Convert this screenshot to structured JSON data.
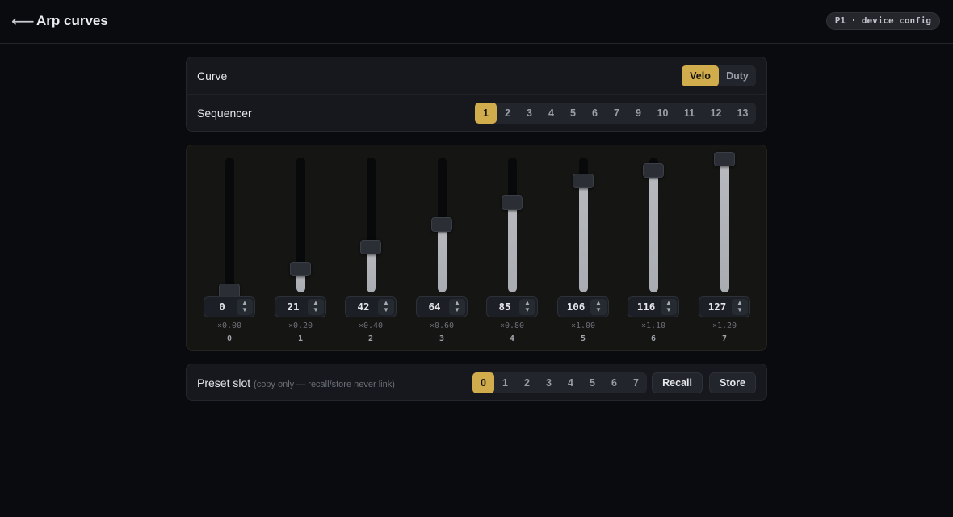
{
  "header": {
    "back_icon": "arrow-left-icon",
    "back_glyph": "⟵",
    "title": "Arp curves",
    "badge": "P1 · device config"
  },
  "curve": {
    "label": "Curve",
    "options": [
      "Velo",
      "Duty"
    ],
    "selected": "Velo"
  },
  "sequencer": {
    "label": "Sequencer",
    "options": [
      "1",
      "2",
      "3",
      "4",
      "5",
      "6",
      "7",
      "9",
      "10",
      "11",
      "12",
      "13"
    ],
    "selected": "1"
  },
  "faders": [
    {
      "value": "0",
      "multiplier": "×0.00",
      "index": "0",
      "level": 0
    },
    {
      "value": "21",
      "multiplier": "×0.20",
      "index": "1",
      "level": 21
    },
    {
      "value": "42",
      "multiplier": "×0.40",
      "index": "2",
      "level": 42
    },
    {
      "value": "64",
      "multiplier": "×0.60",
      "index": "3",
      "level": 64
    },
    {
      "value": "85",
      "multiplier": "×0.80",
      "index": "4",
      "level": 85
    },
    {
      "value": "106",
      "multiplier": "×1.00",
      "index": "5",
      "level": 106
    },
    {
      "value": "116",
      "multiplier": "×1.10",
      "index": "6",
      "level": 116
    },
    {
      "value": "127",
      "multiplier": "×1.20",
      "index": "7",
      "level": 127
    }
  ],
  "fader_max": 127,
  "stepper_icon": "chevron-up-down-icon",
  "preset": {
    "label": "Preset slot",
    "note": "(copy only — recall/store never link)",
    "options": [
      "0",
      "1",
      "2",
      "3",
      "4",
      "5",
      "6",
      "7"
    ],
    "selected": "0",
    "recall_label": "Recall",
    "store_label": "Store"
  },
  "colors": {
    "accent": "#d1ac4d",
    "background": "#0a0b0e",
    "card": "#16181d",
    "fader_fill": "#b7b9be"
  }
}
